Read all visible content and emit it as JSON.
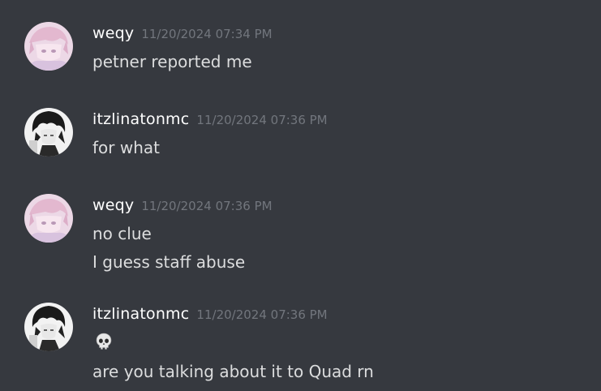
{
  "messages": [
    {
      "author": "weqy",
      "timestamp": "11/20/2024 07:34 PM",
      "avatar": "pink-anime-avatar",
      "lines": [
        "petner reported me"
      ]
    },
    {
      "author": "itzlinatonmc",
      "timestamp": "11/20/2024 07:36 PM",
      "avatar": "dark-anime-avatar",
      "lines": [
        "for what"
      ]
    },
    {
      "author": "weqy",
      "timestamp": "11/20/2024 07:36 PM",
      "avatar": "pink-anime-avatar",
      "lines": [
        "no clue",
        "I guess staff abuse"
      ]
    },
    {
      "author": "itzlinatonmc",
      "timestamp": "11/20/2024 07:36 PM",
      "avatar": "dark-anime-avatar",
      "emoji": "skull-icon",
      "lines": [
        "are you talking about it to Quad rn"
      ]
    }
  ],
  "colors": {
    "background": "#36393f",
    "username": "#ffffff",
    "timestamp": "#72767d",
    "message_text": "#dcddde"
  }
}
